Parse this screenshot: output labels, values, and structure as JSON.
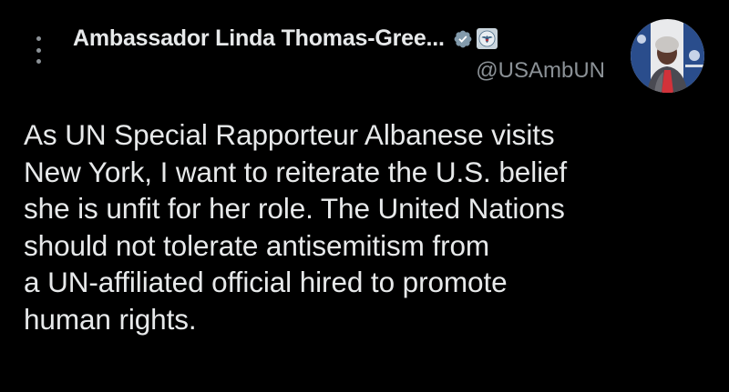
{
  "post": {
    "author": {
      "display_name": "Ambassador Linda Thomas-Gree...",
      "handle": "@USAmbUN",
      "verified_icon": "verified-badge-icon",
      "affiliation_icon": "government-seal-icon",
      "avatar_icon": "profile-photo"
    },
    "more_icon": "vertical-ellipsis-icon",
    "text": "As UN Special Rapporteur Albanese visits\nNew York, I want to reiterate the U.S. belief\nshe is unfit for her role. The United Nations\nshould not tolerate antisemitism from\na UN-affiliated official hired to promote\nhuman rights."
  },
  "colors": {
    "background": "#000000",
    "primary_text": "#e7e9ea",
    "secondary_text": "#8b9196",
    "badge_gray": "#829aab"
  }
}
